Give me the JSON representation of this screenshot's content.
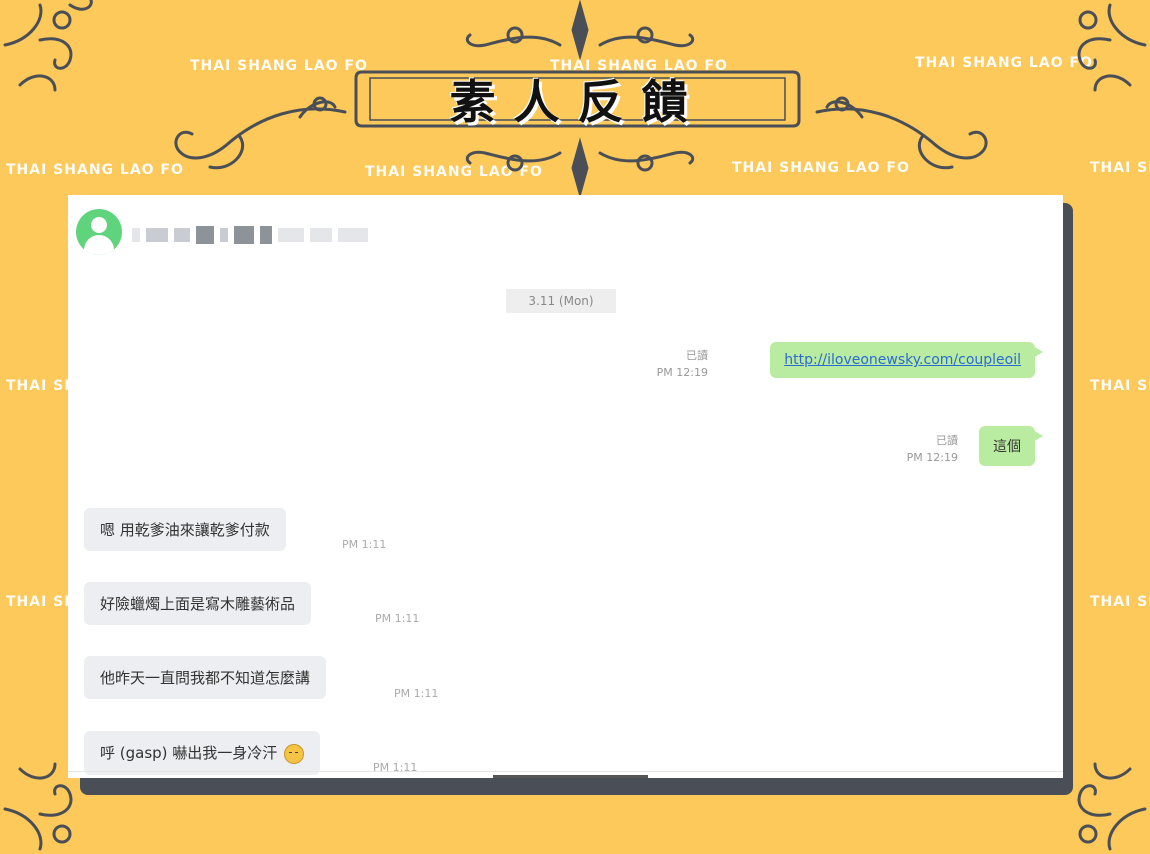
{
  "watermark_text": "THAI SHANG LAO FO",
  "banner": {
    "title": "素人反饋"
  },
  "chat": {
    "date": "3.11 (Mon)",
    "outgoing": [
      {
        "status": "已讀",
        "time": "PM 12:19",
        "text": "http://iloveonewsky.com/coupleoil"
      },
      {
        "status": "已讀",
        "time": "PM 12:19",
        "text": "這個"
      }
    ],
    "incoming": [
      {
        "text": "嗯 用乾爹油來讓乾爹付款",
        "time": "PM 1:11"
      },
      {
        "text": "好險蠟燭上面是寫木雕藝術品",
        "time": "PM 1:11"
      },
      {
        "text": "他昨天一直問我都不知道怎麼講",
        "time": "PM 1:11"
      },
      {
        "text": "呼 (gasp) 嚇出我一身冷汗",
        "time": "PM 1:11"
      }
    ]
  },
  "colors": {
    "background": "#fcc95a",
    "bubble_out": "#b9eca0",
    "bubble_in": "#eceef2",
    "avatar": "#5fd47c",
    "ornament": "#4a4f57"
  },
  "icons": {
    "avatar": "user-avatar-icon",
    "emoji": "sweat-face-emoji-icon"
  }
}
